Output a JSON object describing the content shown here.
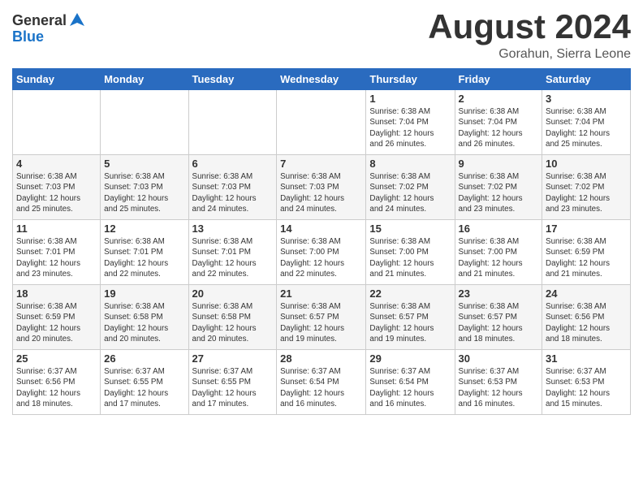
{
  "header": {
    "logo_general": "General",
    "logo_blue": "Blue",
    "month_title": "August 2024",
    "location": "Gorahun, Sierra Leone"
  },
  "weekdays": [
    "Sunday",
    "Monday",
    "Tuesday",
    "Wednesday",
    "Thursday",
    "Friday",
    "Saturday"
  ],
  "weeks": [
    [
      {
        "day": "",
        "info": ""
      },
      {
        "day": "",
        "info": ""
      },
      {
        "day": "",
        "info": ""
      },
      {
        "day": "",
        "info": ""
      },
      {
        "day": "1",
        "info": "Sunrise: 6:38 AM\nSunset: 7:04 PM\nDaylight: 12 hours\nand 26 minutes."
      },
      {
        "day": "2",
        "info": "Sunrise: 6:38 AM\nSunset: 7:04 PM\nDaylight: 12 hours\nand 26 minutes."
      },
      {
        "day": "3",
        "info": "Sunrise: 6:38 AM\nSunset: 7:04 PM\nDaylight: 12 hours\nand 25 minutes."
      }
    ],
    [
      {
        "day": "4",
        "info": "Sunrise: 6:38 AM\nSunset: 7:03 PM\nDaylight: 12 hours\nand 25 minutes."
      },
      {
        "day": "5",
        "info": "Sunrise: 6:38 AM\nSunset: 7:03 PM\nDaylight: 12 hours\nand 25 minutes."
      },
      {
        "day": "6",
        "info": "Sunrise: 6:38 AM\nSunset: 7:03 PM\nDaylight: 12 hours\nand 24 minutes."
      },
      {
        "day": "7",
        "info": "Sunrise: 6:38 AM\nSunset: 7:03 PM\nDaylight: 12 hours\nand 24 minutes."
      },
      {
        "day": "8",
        "info": "Sunrise: 6:38 AM\nSunset: 7:02 PM\nDaylight: 12 hours\nand 24 minutes."
      },
      {
        "day": "9",
        "info": "Sunrise: 6:38 AM\nSunset: 7:02 PM\nDaylight: 12 hours\nand 23 minutes."
      },
      {
        "day": "10",
        "info": "Sunrise: 6:38 AM\nSunset: 7:02 PM\nDaylight: 12 hours\nand 23 minutes."
      }
    ],
    [
      {
        "day": "11",
        "info": "Sunrise: 6:38 AM\nSunset: 7:01 PM\nDaylight: 12 hours\nand 23 minutes."
      },
      {
        "day": "12",
        "info": "Sunrise: 6:38 AM\nSunset: 7:01 PM\nDaylight: 12 hours\nand 22 minutes."
      },
      {
        "day": "13",
        "info": "Sunrise: 6:38 AM\nSunset: 7:01 PM\nDaylight: 12 hours\nand 22 minutes."
      },
      {
        "day": "14",
        "info": "Sunrise: 6:38 AM\nSunset: 7:00 PM\nDaylight: 12 hours\nand 22 minutes."
      },
      {
        "day": "15",
        "info": "Sunrise: 6:38 AM\nSunset: 7:00 PM\nDaylight: 12 hours\nand 21 minutes."
      },
      {
        "day": "16",
        "info": "Sunrise: 6:38 AM\nSunset: 7:00 PM\nDaylight: 12 hours\nand 21 minutes."
      },
      {
        "day": "17",
        "info": "Sunrise: 6:38 AM\nSunset: 6:59 PM\nDaylight: 12 hours\nand 21 minutes."
      }
    ],
    [
      {
        "day": "18",
        "info": "Sunrise: 6:38 AM\nSunset: 6:59 PM\nDaylight: 12 hours\nand 20 minutes."
      },
      {
        "day": "19",
        "info": "Sunrise: 6:38 AM\nSunset: 6:58 PM\nDaylight: 12 hours\nand 20 minutes."
      },
      {
        "day": "20",
        "info": "Sunrise: 6:38 AM\nSunset: 6:58 PM\nDaylight: 12 hours\nand 20 minutes."
      },
      {
        "day": "21",
        "info": "Sunrise: 6:38 AM\nSunset: 6:57 PM\nDaylight: 12 hours\nand 19 minutes."
      },
      {
        "day": "22",
        "info": "Sunrise: 6:38 AM\nSunset: 6:57 PM\nDaylight: 12 hours\nand 19 minutes."
      },
      {
        "day": "23",
        "info": "Sunrise: 6:38 AM\nSunset: 6:57 PM\nDaylight: 12 hours\nand 18 minutes."
      },
      {
        "day": "24",
        "info": "Sunrise: 6:38 AM\nSunset: 6:56 PM\nDaylight: 12 hours\nand 18 minutes."
      }
    ],
    [
      {
        "day": "25",
        "info": "Sunrise: 6:37 AM\nSunset: 6:56 PM\nDaylight: 12 hours\nand 18 minutes."
      },
      {
        "day": "26",
        "info": "Sunrise: 6:37 AM\nSunset: 6:55 PM\nDaylight: 12 hours\nand 17 minutes."
      },
      {
        "day": "27",
        "info": "Sunrise: 6:37 AM\nSunset: 6:55 PM\nDaylight: 12 hours\nand 17 minutes."
      },
      {
        "day": "28",
        "info": "Sunrise: 6:37 AM\nSunset: 6:54 PM\nDaylight: 12 hours\nand 16 minutes."
      },
      {
        "day": "29",
        "info": "Sunrise: 6:37 AM\nSunset: 6:54 PM\nDaylight: 12 hours\nand 16 minutes."
      },
      {
        "day": "30",
        "info": "Sunrise: 6:37 AM\nSunset: 6:53 PM\nDaylight: 12 hours\nand 16 minutes."
      },
      {
        "day": "31",
        "info": "Sunrise: 6:37 AM\nSunset: 6:53 PM\nDaylight: 12 hours\nand 15 minutes."
      }
    ]
  ]
}
